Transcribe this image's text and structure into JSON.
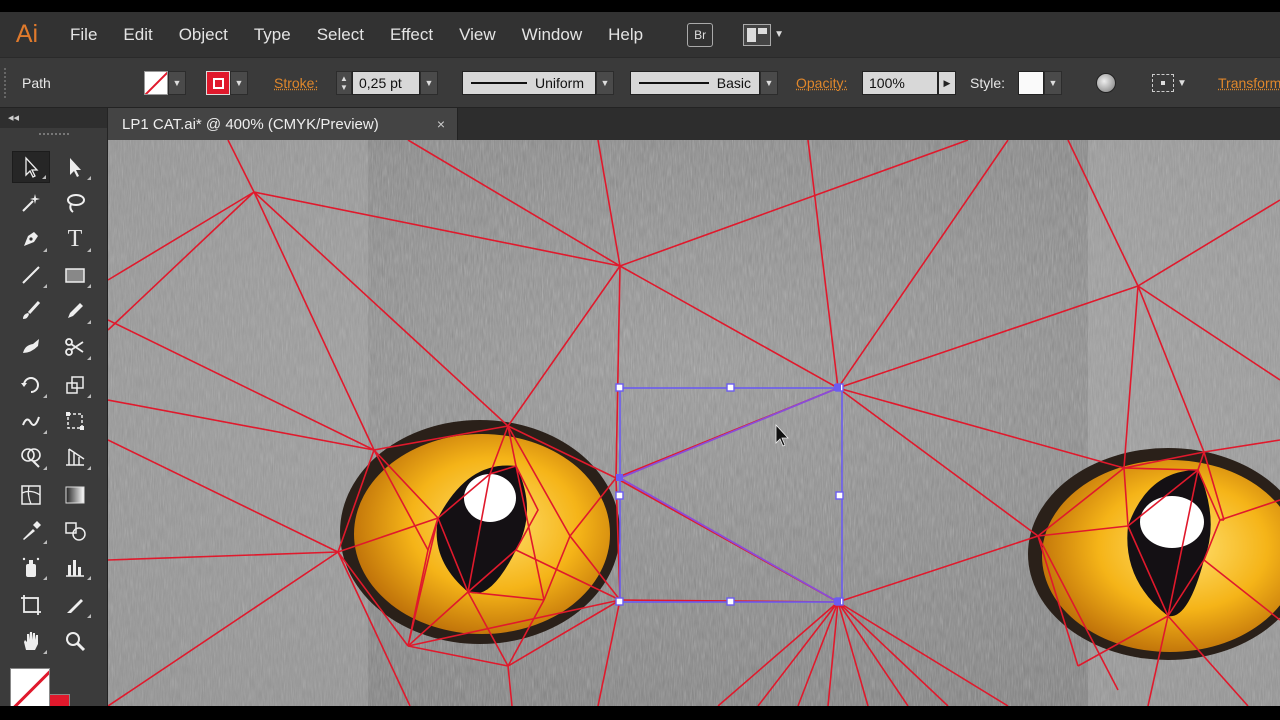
{
  "app": {
    "logo": "Ai"
  },
  "menu": [
    "File",
    "Edit",
    "Object",
    "Type",
    "Select",
    "Effect",
    "View",
    "Window",
    "Help"
  ],
  "menu_extra": {
    "bridge": "Br"
  },
  "control": {
    "selection": "Path",
    "stroke_label": "Stroke:",
    "stroke_weight": "0,25 pt",
    "profile": "Uniform",
    "brush": "Basic",
    "opacity_label": "Opacity:",
    "opacity": "100%",
    "style_label": "Style:",
    "transform_label": "Transform"
  },
  "document": {
    "tab_title": "LP1 CAT.ai* @ 400% (CMYK/Preview)",
    "close": "×"
  },
  "toolpanel": {
    "collapse": "◂◂"
  },
  "tools": [
    "selection-tool",
    "direct-selection-tool",
    "magic-wand-tool",
    "lasso-tool",
    "pen-tool",
    "type-tool",
    "line-segment-tool",
    "rectangle-tool",
    "paintbrush-tool",
    "pencil-tool",
    "blob-brush-tool",
    "scissors-tool",
    "rotate-tool",
    "scale-tool",
    "warp-tool",
    "free-transform-tool",
    "shape-builder-tool",
    "graph-tool",
    "mesh-tool",
    "gradient-tool",
    "eyedropper-tool",
    "blend-tool",
    "symbol-sprayer-tool",
    "column-graph-tool",
    "artboard-tool",
    "slice-tool",
    "hand-tool",
    "zoom-tool"
  ],
  "colors": {
    "accent": "#e0872b",
    "mesh_line": "#e0192c",
    "selection": "#6b5cf0",
    "fill_stroke": "#e0192c"
  }
}
